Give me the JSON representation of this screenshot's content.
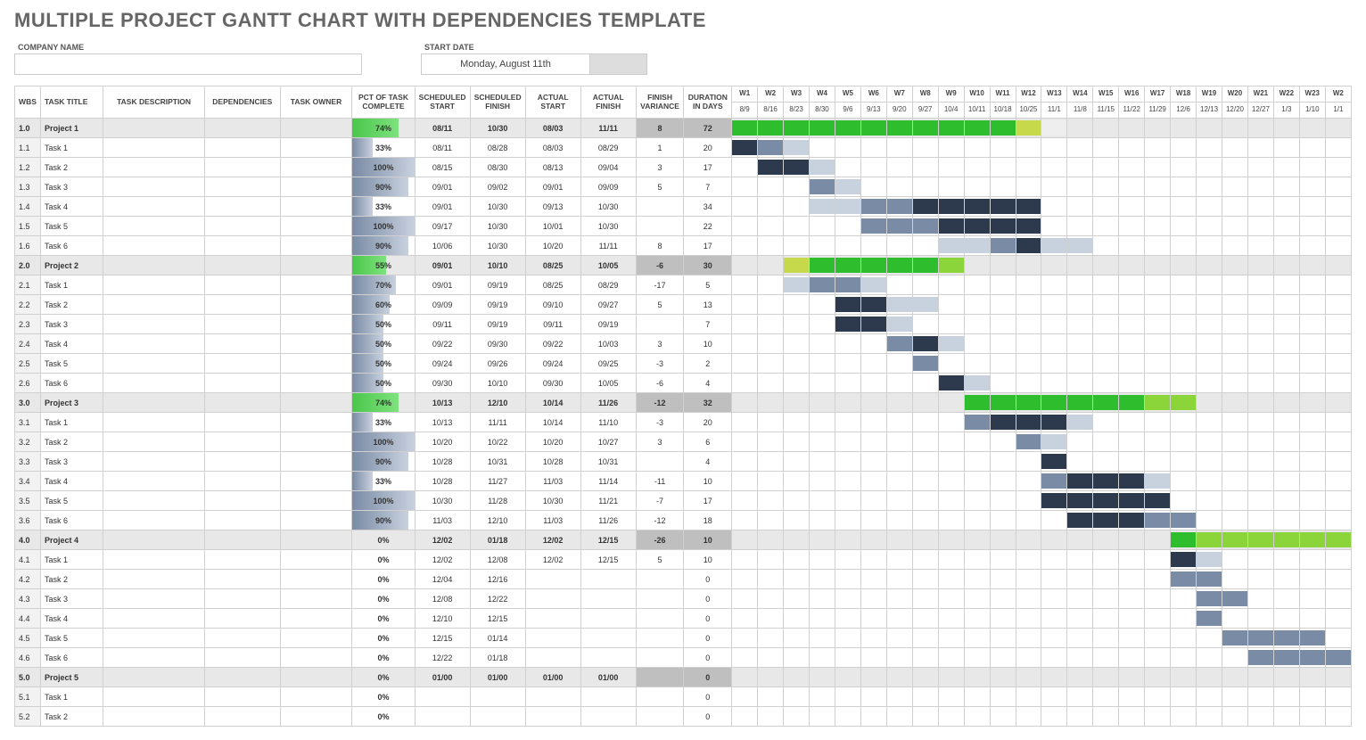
{
  "page_title": "MULTIPLE PROJECT GANTT CHART WITH DEPENDENCIES TEMPLATE",
  "meta": {
    "company_label": "COMPANY NAME",
    "company_value": "",
    "start_label": "START DATE",
    "start_value": "Monday, August 11th"
  },
  "headers": {
    "wbs": "WBS",
    "task_title": "TASK TITLE",
    "task_desc": "TASK DESCRIPTION",
    "dependencies": "DEPENDENCIES",
    "task_owner": "TASK OWNER",
    "pct": "PCT OF TASK COMPLETE",
    "sched_start": "SCHEDULED START",
    "sched_finish": "SCHEDULED FINISH",
    "actual_start": "ACTUAL START",
    "actual_finish": "ACTUAL FINISH",
    "finish_var": "FINISH VARIANCE",
    "duration": "DURATION IN DAYS"
  },
  "weeks": [
    {
      "w": "W1",
      "d": "8/9"
    },
    {
      "w": "W2",
      "d": "8/16"
    },
    {
      "w": "W3",
      "d": "8/23"
    },
    {
      "w": "W4",
      "d": "8/30"
    },
    {
      "w": "W5",
      "d": "9/6"
    },
    {
      "w": "W6",
      "d": "9/13"
    },
    {
      "w": "W7",
      "d": "9/20"
    },
    {
      "w": "W8",
      "d": "9/27"
    },
    {
      "w": "W9",
      "d": "10/4"
    },
    {
      "w": "W10",
      "d": "10/11"
    },
    {
      "w": "W11",
      "d": "10/18"
    },
    {
      "w": "W12",
      "d": "10/25"
    },
    {
      "w": "W13",
      "d": "11/1"
    },
    {
      "w": "W14",
      "d": "11/8"
    },
    {
      "w": "W15",
      "d": "11/15"
    },
    {
      "w": "W16",
      "d": "11/22"
    },
    {
      "w": "W17",
      "d": "11/29"
    },
    {
      "w": "W18",
      "d": "12/6"
    },
    {
      "w": "W19",
      "d": "12/13"
    },
    {
      "w": "W20",
      "d": "12/20"
    },
    {
      "w": "W21",
      "d": "12/27"
    },
    {
      "w": "W22",
      "d": "1/3"
    },
    {
      "w": "W23",
      "d": "1/10"
    },
    {
      "w": "W2",
      "d": "1/1"
    }
  ],
  "rows": [
    {
      "wbs": "1.0",
      "title": "Project 1",
      "project": true,
      "pct": "74%",
      "pct_fill": 74,
      "pct_color": "green",
      "ss": "08/11",
      "sf": "10/30",
      "as": "08/03",
      "af": "11/11",
      "fv": "8",
      "dur": "72",
      "bars": [
        {
          "s": 0,
          "e": 11,
          "c": "g-green"
        },
        {
          "s": 11,
          "e": 12,
          "c": "g-ygreen"
        },
        {
          "s": 12,
          "e": 13,
          "c": "g-ext-light"
        }
      ]
    },
    {
      "wbs": "1.1",
      "title": "Task 1",
      "pct": "33%",
      "pct_fill": 33,
      "pct_color": "blue",
      "ss": "08/11",
      "sf": "08/28",
      "as": "08/03",
      "af": "08/29",
      "fv": "1",
      "dur": "20",
      "bars": [
        {
          "s": 0,
          "e": 1,
          "c": "g-dark"
        },
        {
          "s": 1,
          "e": 2,
          "c": "g-mid"
        },
        {
          "s": 2,
          "e": 3,
          "c": "g-light"
        }
      ]
    },
    {
      "wbs": "1.2",
      "title": "Task 2",
      "pct": "100%",
      "pct_fill": 100,
      "pct_color": "blue",
      "ss": "08/15",
      "sf": "08/30",
      "as": "08/13",
      "af": "09/04",
      "fv": "3",
      "dur": "17",
      "bars": [
        {
          "s": 1,
          "e": 3,
          "c": "g-dark"
        },
        {
          "s": 3,
          "e": 4,
          "c": "g-light"
        }
      ]
    },
    {
      "wbs": "1.3",
      "title": "Task 3",
      "pct": "90%",
      "pct_fill": 90,
      "pct_color": "blue",
      "ss": "09/01",
      "sf": "09/02",
      "as": "09/01",
      "af": "09/09",
      "fv": "5",
      "dur": "7",
      "bars": [
        {
          "s": 3,
          "e": 4,
          "c": "g-mid"
        },
        {
          "s": 4,
          "e": 5,
          "c": "g-light"
        }
      ]
    },
    {
      "wbs": "1.4",
      "title": "Task 4",
      "pct": "33%",
      "pct_fill": 33,
      "pct_color": "blue",
      "ss": "09/01",
      "sf": "10/30",
      "as": "09/13",
      "af": "10/30",
      "fv": "",
      "dur": "34",
      "bars": [
        {
          "s": 3,
          "e": 5,
          "c": "g-light"
        },
        {
          "s": 5,
          "e": 7,
          "c": "g-mid"
        },
        {
          "s": 7,
          "e": 12,
          "c": "g-dark"
        }
      ]
    },
    {
      "wbs": "1.5",
      "title": "Task 5",
      "pct": "100%",
      "pct_fill": 100,
      "pct_color": "blue",
      "ss": "09/17",
      "sf": "10/30",
      "as": "10/01",
      "af": "10/30",
      "fv": "",
      "dur": "22",
      "bars": [
        {
          "s": 5,
          "e": 8,
          "c": "g-mid"
        },
        {
          "s": 8,
          "e": 12,
          "c": "g-dark"
        }
      ]
    },
    {
      "wbs": "1.6",
      "title": "Task 6",
      "pct": "90%",
      "pct_fill": 90,
      "pct_color": "blue",
      "ss": "10/06",
      "sf": "10/30",
      "as": "10/20",
      "af": "11/11",
      "fv": "8",
      "dur": "17",
      "bars": [
        {
          "s": 8,
          "e": 10,
          "c": "g-light"
        },
        {
          "s": 10,
          "e": 11,
          "c": "g-mid"
        },
        {
          "s": 11,
          "e": 12,
          "c": "g-dark"
        },
        {
          "s": 12,
          "e": 14,
          "c": "g-light"
        }
      ]
    },
    {
      "wbs": "2.0",
      "title": "Project 2",
      "project": true,
      "pct": "55%",
      "pct_fill": 55,
      "pct_color": "green",
      "ss": "09/01",
      "sf": "10/10",
      "as": "08/25",
      "af": "10/05",
      "fv": "-6",
      "dur": "30",
      "bars": [
        {
          "s": 2,
          "e": 3,
          "c": "g-ygreen"
        },
        {
          "s": 3,
          "e": 8,
          "c": "g-green"
        },
        {
          "s": 8,
          "e": 9,
          "c": "g-lgreen"
        }
      ]
    },
    {
      "wbs": "2.1",
      "title": "Task 1",
      "pct": "70%",
      "pct_fill": 70,
      "pct_color": "blue",
      "ss": "09/01",
      "sf": "09/19",
      "as": "08/25",
      "af": "08/29",
      "fv": "-17",
      "dur": "5",
      "bars": [
        {
          "s": 2,
          "e": 3,
          "c": "g-light"
        },
        {
          "s": 3,
          "e": 5,
          "c": "g-mid"
        },
        {
          "s": 5,
          "e": 6,
          "c": "g-light"
        }
      ]
    },
    {
      "wbs": "2.2",
      "title": "Task 2",
      "pct": "60%",
      "pct_fill": 60,
      "pct_color": "blue",
      "ss": "09/09",
      "sf": "09/19",
      "as": "09/10",
      "af": "09/27",
      "fv": "5",
      "dur": "13",
      "bars": [
        {
          "s": 4,
          "e": 6,
          "c": "g-dark"
        },
        {
          "s": 6,
          "e": 8,
          "c": "g-light"
        }
      ]
    },
    {
      "wbs": "2.3",
      "title": "Task 3",
      "pct": "50%",
      "pct_fill": 50,
      "pct_color": "blue",
      "ss": "09/11",
      "sf": "09/19",
      "as": "09/11",
      "af": "09/19",
      "fv": "",
      "dur": "7",
      "bars": [
        {
          "s": 4,
          "e": 6,
          "c": "g-dark"
        },
        {
          "s": 6,
          "e": 7,
          "c": "g-light"
        }
      ]
    },
    {
      "wbs": "2.4",
      "title": "Task 4",
      "pct": "50%",
      "pct_fill": 50,
      "pct_color": "blue",
      "ss": "09/22",
      "sf": "09/30",
      "as": "09/22",
      "af": "10/03",
      "fv": "3",
      "dur": "10",
      "bars": [
        {
          "s": 6,
          "e": 7,
          "c": "g-mid"
        },
        {
          "s": 7,
          "e": 8,
          "c": "g-dark"
        },
        {
          "s": 8,
          "e": 9,
          "c": "g-light"
        }
      ]
    },
    {
      "wbs": "2.5",
      "title": "Task 5",
      "pct": "50%",
      "pct_fill": 50,
      "pct_color": "blue",
      "ss": "09/24",
      "sf": "09/26",
      "as": "09/24",
      "af": "09/25",
      "fv": "-3",
      "dur": "2",
      "bars": [
        {
          "s": 7,
          "e": 8,
          "c": "g-mid"
        }
      ]
    },
    {
      "wbs": "2.6",
      "title": "Task 6",
      "pct": "50%",
      "pct_fill": 50,
      "pct_color": "blue",
      "ss": "09/30",
      "sf": "10/10",
      "as": "09/30",
      "af": "10/05",
      "fv": "-6",
      "dur": "4",
      "bars": [
        {
          "s": 8,
          "e": 9,
          "c": "g-dark"
        },
        {
          "s": 9,
          "e": 10,
          "c": "g-light"
        }
      ]
    },
    {
      "wbs": "3.0",
      "title": "Project 3",
      "project": true,
      "pct": "74%",
      "pct_fill": 74,
      "pct_color": "green",
      "ss": "10/13",
      "sf": "12/10",
      "as": "10/14",
      "af": "11/26",
      "fv": "-12",
      "dur": "32",
      "bars": [
        {
          "s": 9,
          "e": 16,
          "c": "g-green"
        },
        {
          "s": 16,
          "e": 18,
          "c": "g-lgreen"
        }
      ]
    },
    {
      "wbs": "3.1",
      "title": "Task 1",
      "pct": "33%",
      "pct_fill": 33,
      "pct_color": "blue",
      "ss": "10/13",
      "sf": "11/11",
      "as": "10/14",
      "af": "11/10",
      "fv": "-3",
      "dur": "20",
      "bars": [
        {
          "s": 9,
          "e": 10,
          "c": "g-mid"
        },
        {
          "s": 10,
          "e": 13,
          "c": "g-dark"
        },
        {
          "s": 13,
          "e": 14,
          "c": "g-light"
        }
      ]
    },
    {
      "wbs": "3.2",
      "title": "Task 2",
      "pct": "100%",
      "pct_fill": 100,
      "pct_color": "blue",
      "ss": "10/20",
      "sf": "10/22",
      "as": "10/20",
      "af": "10/27",
      "fv": "3",
      "dur": "6",
      "bars": [
        {
          "s": 11,
          "e": 12,
          "c": "g-mid"
        },
        {
          "s": 12,
          "e": 13,
          "c": "g-light"
        }
      ]
    },
    {
      "wbs": "3.3",
      "title": "Task 3",
      "pct": "90%",
      "pct_fill": 90,
      "pct_color": "blue",
      "ss": "10/28",
      "sf": "10/31",
      "as": "10/28",
      "af": "10/31",
      "fv": "",
      "dur": "4",
      "bars": [
        {
          "s": 12,
          "e": 13,
          "c": "g-dark"
        }
      ]
    },
    {
      "wbs": "3.4",
      "title": "Task 4",
      "pct": "33%",
      "pct_fill": 33,
      "pct_color": "blue",
      "ss": "10/28",
      "sf": "11/27",
      "as": "11/03",
      "af": "11/14",
      "fv": "-11",
      "dur": "10",
      "bars": [
        {
          "s": 12,
          "e": 13,
          "c": "g-mid"
        },
        {
          "s": 13,
          "e": 16,
          "c": "g-dark"
        },
        {
          "s": 16,
          "e": 17,
          "c": "g-light"
        }
      ]
    },
    {
      "wbs": "3.5",
      "title": "Task 5",
      "pct": "100%",
      "pct_fill": 100,
      "pct_color": "blue",
      "ss": "10/30",
      "sf": "11/28",
      "as": "10/30",
      "af": "11/21",
      "fv": "-7",
      "dur": "17",
      "bars": [
        {
          "s": 12,
          "e": 17,
          "c": "g-dark"
        }
      ]
    },
    {
      "wbs": "3.6",
      "title": "Task 6",
      "pct": "90%",
      "pct_fill": 90,
      "pct_color": "blue",
      "ss": "11/03",
      "sf": "12/10",
      "as": "11/03",
      "af": "11/26",
      "fv": "-12",
      "dur": "18",
      "bars": [
        {
          "s": 13,
          "e": 16,
          "c": "g-dark"
        },
        {
          "s": 16,
          "e": 18,
          "c": "g-mid"
        }
      ]
    },
    {
      "wbs": "4.0",
      "title": "Project 4",
      "project": true,
      "pct": "0%",
      "pct_fill": 0,
      "pct_color": "green",
      "ss": "12/02",
      "sf": "01/18",
      "as": "12/02",
      "af": "12/15",
      "fv": "-26",
      "dur": "10",
      "bars": [
        {
          "s": 17,
          "e": 18,
          "c": "g-green"
        },
        {
          "s": 18,
          "e": 19,
          "c": "g-lgreen"
        },
        {
          "s": 19,
          "e": 24,
          "c": "g-lgreen"
        }
      ]
    },
    {
      "wbs": "4.1",
      "title": "Task 1",
      "pct": "0%",
      "pct_fill": 0,
      "pct_color": "blue",
      "ss": "12/02",
      "sf": "12/08",
      "as": "12/02",
      "af": "12/15",
      "fv": "5",
      "dur": "10",
      "bars": [
        {
          "s": 17,
          "e": 18,
          "c": "g-dark"
        },
        {
          "s": 18,
          "e": 19,
          "c": "g-light"
        }
      ]
    },
    {
      "wbs": "4.2",
      "title": "Task 2",
      "pct": "0%",
      "pct_fill": 0,
      "pct_color": "blue",
      "ss": "12/04",
      "sf": "12/16",
      "as": "",
      "af": "",
      "fv": "",
      "dur": "0",
      "bars": [
        {
          "s": 17,
          "e": 19,
          "c": "g-mid"
        }
      ]
    },
    {
      "wbs": "4.3",
      "title": "Task 3",
      "pct": "0%",
      "pct_fill": 0,
      "pct_color": "blue",
      "ss": "12/08",
      "sf": "12/22",
      "as": "",
      "af": "",
      "fv": "",
      "dur": "0",
      "bars": [
        {
          "s": 18,
          "e": 20,
          "c": "g-mid"
        }
      ]
    },
    {
      "wbs": "4.4",
      "title": "Task 4",
      "pct": "0%",
      "pct_fill": 0,
      "pct_color": "blue",
      "ss": "12/10",
      "sf": "12/15",
      "as": "",
      "af": "",
      "fv": "",
      "dur": "0",
      "bars": [
        {
          "s": 18,
          "e": 19,
          "c": "g-mid"
        }
      ]
    },
    {
      "wbs": "4.5",
      "title": "Task 5",
      "pct": "0%",
      "pct_fill": 0,
      "pct_color": "blue",
      "ss": "12/15",
      "sf": "01/14",
      "as": "",
      "af": "",
      "fv": "",
      "dur": "0",
      "bars": [
        {
          "s": 19,
          "e": 23,
          "c": "g-mid"
        }
      ]
    },
    {
      "wbs": "4.6",
      "title": "Task 6",
      "pct": "0%",
      "pct_fill": 0,
      "pct_color": "blue",
      "ss": "12/22",
      "sf": "01/18",
      "as": "",
      "af": "",
      "fv": "",
      "dur": "0",
      "bars": [
        {
          "s": 20,
          "e": 24,
          "c": "g-mid"
        }
      ]
    },
    {
      "wbs": "5.0",
      "title": "Project 5",
      "project": true,
      "pct": "0%",
      "pct_fill": 0,
      "pct_color": "green",
      "ss": "01/00",
      "sf": "01/00",
      "as": "01/00",
      "af": "01/00",
      "fv": "",
      "dur": "0",
      "bars": []
    },
    {
      "wbs": "5.1",
      "title": "Task 1",
      "pct": "0%",
      "pct_fill": 0,
      "pct_color": "blue",
      "ss": "",
      "sf": "",
      "as": "",
      "af": "",
      "fv": "",
      "dur": "0",
      "bars": []
    },
    {
      "wbs": "5.2",
      "title": "Task 2",
      "pct": "0%",
      "pct_fill": 0,
      "pct_color": "blue",
      "ss": "",
      "sf": "",
      "as": "",
      "af": "",
      "fv": "",
      "dur": "0",
      "bars": []
    }
  ]
}
